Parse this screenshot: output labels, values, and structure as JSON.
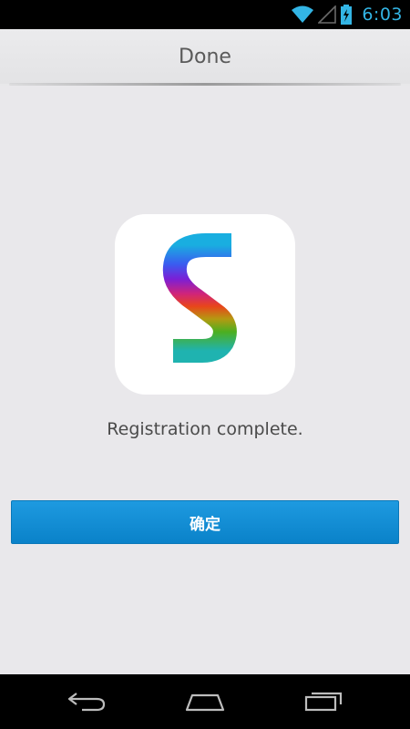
{
  "status_bar": {
    "time": "6:03",
    "icons": [
      "wifi-icon",
      "signal-icon",
      "battery-charging-icon"
    ]
  },
  "header": {
    "title": "Done"
  },
  "main": {
    "logo_icon": "app-logo-s-icon",
    "message": "Registration complete.",
    "confirm_label": "确定"
  },
  "nav_bar": {
    "icons": [
      "back-icon",
      "home-icon",
      "recent-apps-icon"
    ]
  },
  "colors": {
    "accent": "#33b5e5",
    "button": "#0f8bd3"
  }
}
